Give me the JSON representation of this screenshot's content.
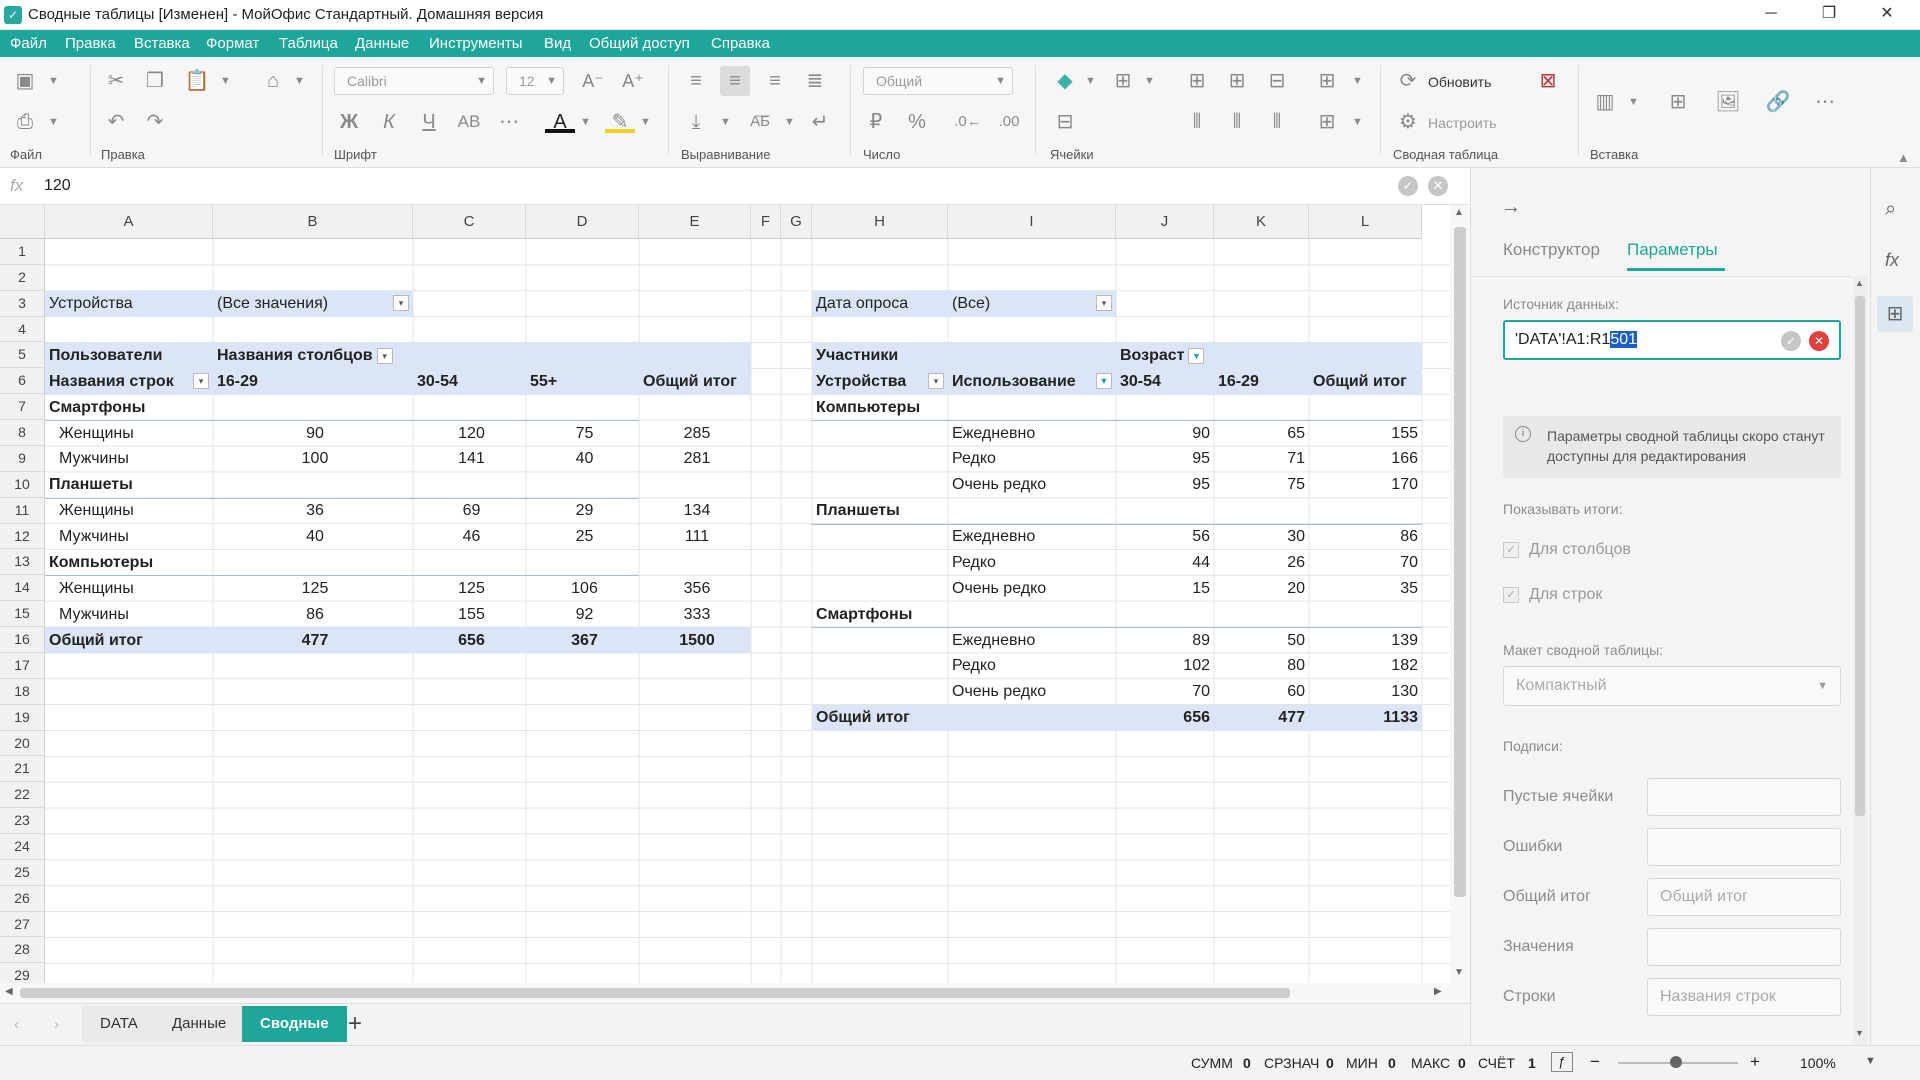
{
  "window": {
    "title": "Сводные таблицы [Изменен] - МойОфис Стандартный. Домашняя версия",
    "minimize": "─",
    "maximize": "❐",
    "close": "✕"
  },
  "menu": [
    "Файл",
    "Правка",
    "Вставка",
    "Формат",
    "Таблица",
    "Данные",
    "Инструменты",
    "Вид",
    "Общий доступ",
    "Справка"
  ],
  "ribbon": {
    "groups": {
      "file": "Файл",
      "edit": "Правка",
      "font": "Шрифт",
      "align": "Выравнивание",
      "number": "Число",
      "cells": "Ячейки",
      "pivot": "Сводная таблица",
      "insert": "Вставка"
    },
    "font_name": "Calibri",
    "font_size": "12",
    "number_format": "Общий",
    "refresh_label": "Обновить",
    "configure_label": "Настроить",
    "bold": "Ж",
    "italic": "К",
    "underline": "Ч",
    "strike": "АВ",
    "currency": "₽",
    "percent": "%"
  },
  "formula": {
    "fx": "fx",
    "value": "120"
  },
  "columns": [
    "A",
    "B",
    "C",
    "D",
    "E",
    "F",
    "G",
    "H",
    "I",
    "J",
    "K",
    "L"
  ],
  "rows": [
    "1",
    "2",
    "3",
    "4",
    "5",
    "6",
    "7",
    "8",
    "9",
    "10",
    "11",
    "12",
    "13",
    "14",
    "15",
    "16",
    "17",
    "18",
    "19",
    "20",
    "21",
    "22",
    "23",
    "24",
    "25",
    "26",
    "27",
    "28",
    "29"
  ],
  "pivot1": {
    "filter_label": "Устройства",
    "filter_value": "(Все значения)",
    "values_label": "Пользователи",
    "col_header_label": "Названия столбцов",
    "row_header_label": "Названия строк",
    "col_headers": [
      "16-29",
      "30-54",
      "55+",
      "Общий итог"
    ],
    "groups": [
      {
        "name": "Смартфоны",
        "rows": [
          {
            "label": "Женщины",
            "values": [
              "90",
              "120",
              "75",
              "285"
            ]
          },
          {
            "label": "Мужчины",
            "values": [
              "100",
              "141",
              "40",
              "281"
            ]
          }
        ]
      },
      {
        "name": "Планшеты",
        "rows": [
          {
            "label": "Женщины",
            "values": [
              "36",
              "69",
              "29",
              "134"
            ]
          },
          {
            "label": "Мужчины",
            "values": [
              "40",
              "46",
              "25",
              "111"
            ]
          }
        ]
      },
      {
        "name": "Компьютеры",
        "rows": [
          {
            "label": "Женщины",
            "values": [
              "125",
              "125",
              "106",
              "356"
            ]
          },
          {
            "label": "Мужчины",
            "values": [
              "86",
              "155",
              "92",
              "333"
            ]
          }
        ]
      }
    ],
    "total_label": "Общий итог",
    "totals": [
      "477",
      "656",
      "367",
      "1500"
    ]
  },
  "pivot2": {
    "filter_label": "Дата опроса",
    "filter_value": "(Все)",
    "values_label": "Участники",
    "col_field_label": "Возраст",
    "row_field1": "Устройства",
    "row_field2": "Использование",
    "col_headers": [
      "30-54",
      "16-29",
      "Общий итог"
    ],
    "groups": [
      {
        "name": "Компьютеры",
        "rows": [
          {
            "label": "Ежедневно",
            "values": [
              "90",
              "65",
              "155"
            ]
          },
          {
            "label": "Редко",
            "values": [
              "95",
              "71",
              "166"
            ]
          },
          {
            "label": "Очень редко",
            "values": [
              "95",
              "75",
              "170"
            ]
          }
        ]
      },
      {
        "name": "Планшеты",
        "rows": [
          {
            "label": "Ежедневно",
            "values": [
              "56",
              "30",
              "86"
            ]
          },
          {
            "label": "Редко",
            "values": [
              "44",
              "26",
              "70"
            ]
          },
          {
            "label": "Очень редко",
            "values": [
              "15",
              "20",
              "35"
            ]
          }
        ]
      },
      {
        "name": "Смартфоны",
        "rows": [
          {
            "label": "Ежедневно",
            "values": [
              "89",
              "50",
              "139"
            ]
          },
          {
            "label": "Редко",
            "values": [
              "102",
              "80",
              "182"
            ]
          },
          {
            "label": "Очень редко",
            "values": [
              "70",
              "60",
              "130"
            ]
          }
        ]
      }
    ],
    "total_label": "Общий итог",
    "totals": [
      "656",
      "477",
      "1133"
    ]
  },
  "sheets": [
    "DATA",
    "Данные",
    "Сводные"
  ],
  "active_sheet": "Сводные",
  "add_sheet": "+",
  "status": {
    "sum_label": "СУММ",
    "sum": "0",
    "avg_label": "СРЗНАЧ",
    "avg": "0",
    "min_label": "МИН",
    "min": "0",
    "max_label": "МАКС",
    "max": "0",
    "count_label": "СЧЁТ",
    "count": "1",
    "zoom": "100%",
    "zoom_minus": "−",
    "zoom_plus": "+"
  },
  "panel": {
    "back": "→",
    "tab_constructor": "Конструктор",
    "tab_params": "Параметры",
    "source_label": "Источник данных:",
    "source_value_plain": "'DATA'!A1:R1",
    "source_value_selected": "501",
    "info_text": "Параметры сводной таблицы скоро станут доступны для редактирования",
    "show_totals_label": "Показывать итоги:",
    "for_columns": "Для столбцов",
    "for_rows": "Для строк",
    "layout_label": "Макет сводной таблицы:",
    "layout_value": "Компактный",
    "captions_label": "Подписи:",
    "fields": [
      {
        "label": "Пустые ячейки",
        "placeholder": ""
      },
      {
        "label": "Ошибки",
        "placeholder": ""
      },
      {
        "label": "Общий итог",
        "placeholder": "Общий итог"
      },
      {
        "label": "Значения",
        "placeholder": ""
      },
      {
        "label": "Строки",
        "placeholder": "Названия строк"
      }
    ]
  },
  "colors": {
    "accent": "#1fa69a",
    "pivot_header": "#dbe5f5",
    "selection": "#1a5fc7"
  }
}
